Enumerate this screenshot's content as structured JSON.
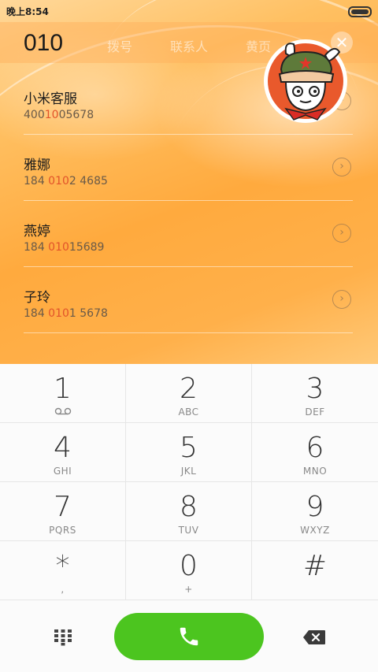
{
  "status_bar": {
    "time": "晚上8:54"
  },
  "dialer": {
    "dialed_number": "010",
    "tabs": [
      "拨号",
      "联系人",
      "黄页"
    ]
  },
  "contacts": [
    {
      "name": "小米客服",
      "number_before": "400",
      "number_match": "10",
      "number_after": "05678"
    },
    {
      "name": "雅娜",
      "number_before": "184 ",
      "number_match": "010",
      "number_after": "2 4685"
    },
    {
      "name": "燕婷",
      "number_before": "184 ",
      "number_match": "010",
      "number_after": "15689"
    },
    {
      "name": "子玲",
      "number_before": "184 ",
      "number_match": "010",
      "number_after": "1 5678"
    }
  ],
  "keypad": [
    {
      "digit": "1",
      "sub": ""
    },
    {
      "digit": "2",
      "sub": "ABC"
    },
    {
      "digit": "3",
      "sub": "DEF"
    },
    {
      "digit": "4",
      "sub": "GHI"
    },
    {
      "digit": "5",
      "sub": "JKL"
    },
    {
      "digit": "6",
      "sub": "MNO"
    },
    {
      "digit": "7",
      "sub": "PQRS"
    },
    {
      "digit": "8",
      "sub": "TUV"
    },
    {
      "digit": "9",
      "sub": "WXYZ"
    },
    {
      "digit": "*",
      "sub": ","
    },
    {
      "digit": "0",
      "sub": "+"
    },
    {
      "digit": "#",
      "sub": ""
    }
  ],
  "icons": {
    "voicemail": "voicemail-icon",
    "close": "close-icon",
    "call": "phone-icon",
    "keypad_toggle": "dialpad-icon",
    "delete": "backspace-icon",
    "contact_detail": "chevron-right-icon"
  },
  "colors": {
    "call_button": "#4cc51f",
    "highlight": "#e2532a"
  }
}
